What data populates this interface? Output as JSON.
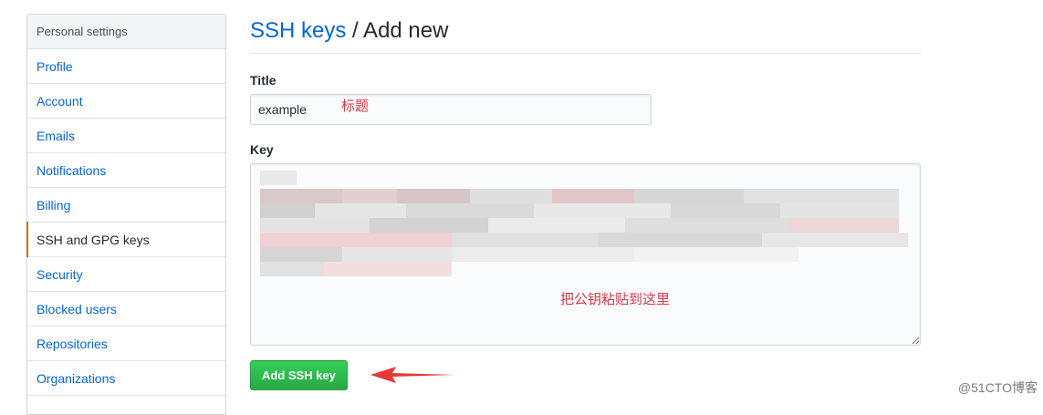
{
  "sidebar": {
    "header": "Personal settings",
    "items": [
      {
        "label": "Profile"
      },
      {
        "label": "Account"
      },
      {
        "label": "Emails"
      },
      {
        "label": "Notifications"
      },
      {
        "label": "Billing"
      },
      {
        "label": "SSH and GPG keys",
        "selected": true
      },
      {
        "label": "Security"
      },
      {
        "label": "Blocked users"
      },
      {
        "label": "Repositories"
      },
      {
        "label": "Organizations"
      }
    ]
  },
  "page": {
    "breadcrumb_link": "SSH keys",
    "breadcrumb_current": " / Add new"
  },
  "form": {
    "title_label": "Title",
    "title_value": "example",
    "key_label": "Key",
    "submit_label": "Add SSH key"
  },
  "annotations": {
    "title_note": "标题",
    "key_note": "把公钥粘贴到这里"
  },
  "watermark": "@51CTO博客",
  "colors": {
    "link": "#0366d6",
    "selected_accent": "#e36209",
    "button": "#28a745",
    "annotation": "#d73a49"
  }
}
